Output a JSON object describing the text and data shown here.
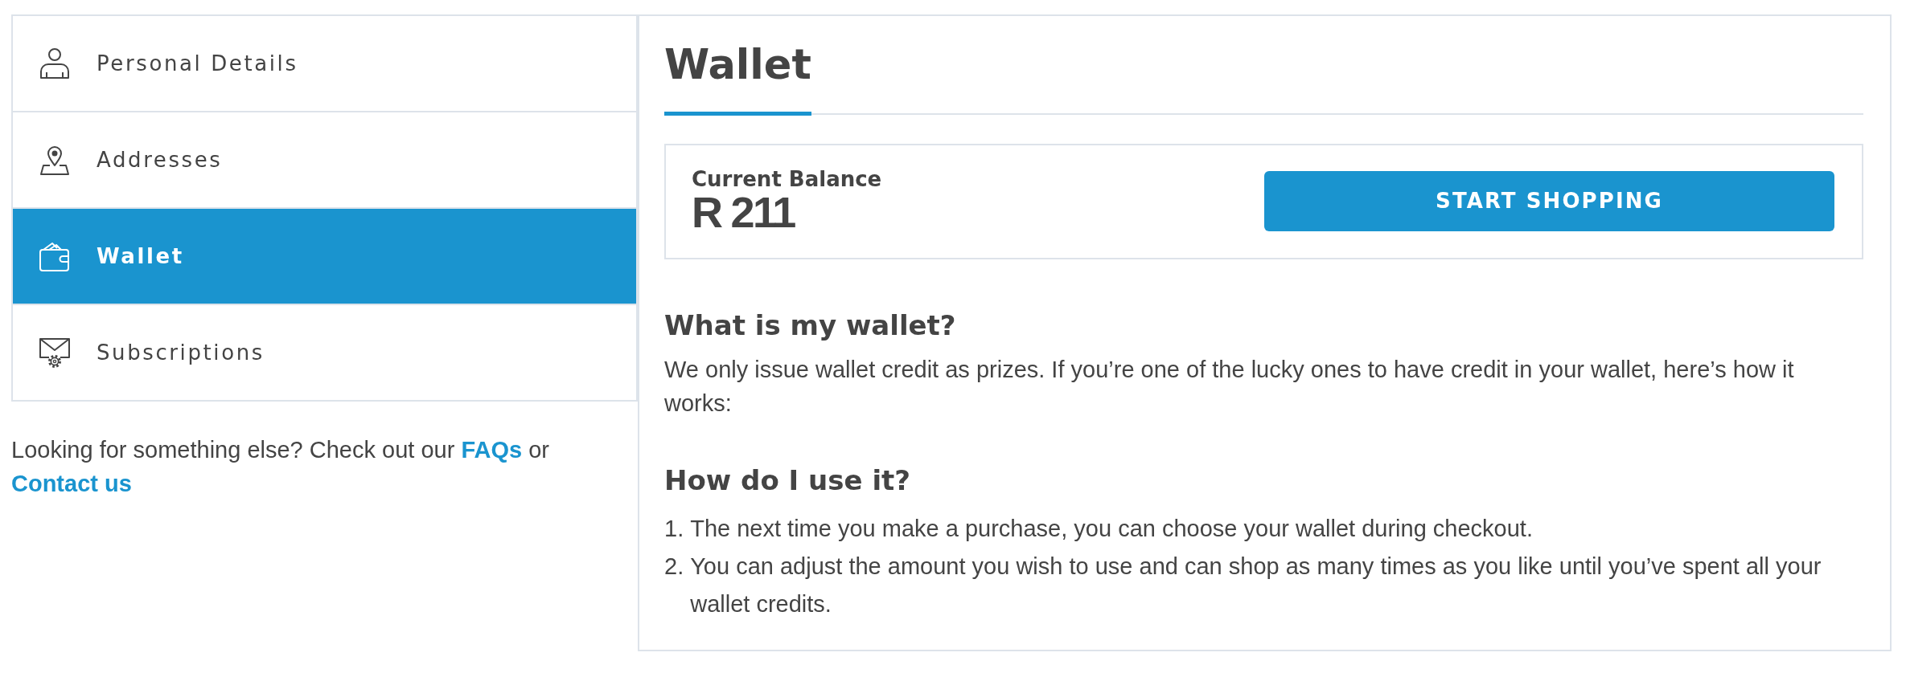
{
  "sidebar": {
    "items": [
      {
        "label": "Personal Details",
        "selected": false
      },
      {
        "label": "Addresses",
        "selected": false
      },
      {
        "label": "Wallet",
        "selected": true
      },
      {
        "label": "Subscriptions",
        "selected": false
      }
    ],
    "help": {
      "text": "Looking for something else? Check out our",
      "faq_link": "FAQs",
      "joiner": "or",
      "contact_link": "Contact us"
    }
  },
  "main": {
    "title": "Wallet",
    "balance": {
      "label": "Current Balance",
      "amount": "R 211"
    },
    "button": "START SHOPPING",
    "about": {
      "heading": "What is my wallet?",
      "text": "We only issue wallet credit as prizes. If you’re one of the lucky ones to have credit in your wallet, here’s how it works:"
    },
    "usage": {
      "heading": "How do I use it?",
      "steps": [
        {
          "number": "1.",
          "text": "The next time you make a purchase, you can choose your wallet during checkout."
        },
        {
          "number": "2.",
          "text": "You can adjust the amount you wish to use and can shop as many times as you like until you’ve spent all your wallet credits."
        }
      ]
    }
  }
}
